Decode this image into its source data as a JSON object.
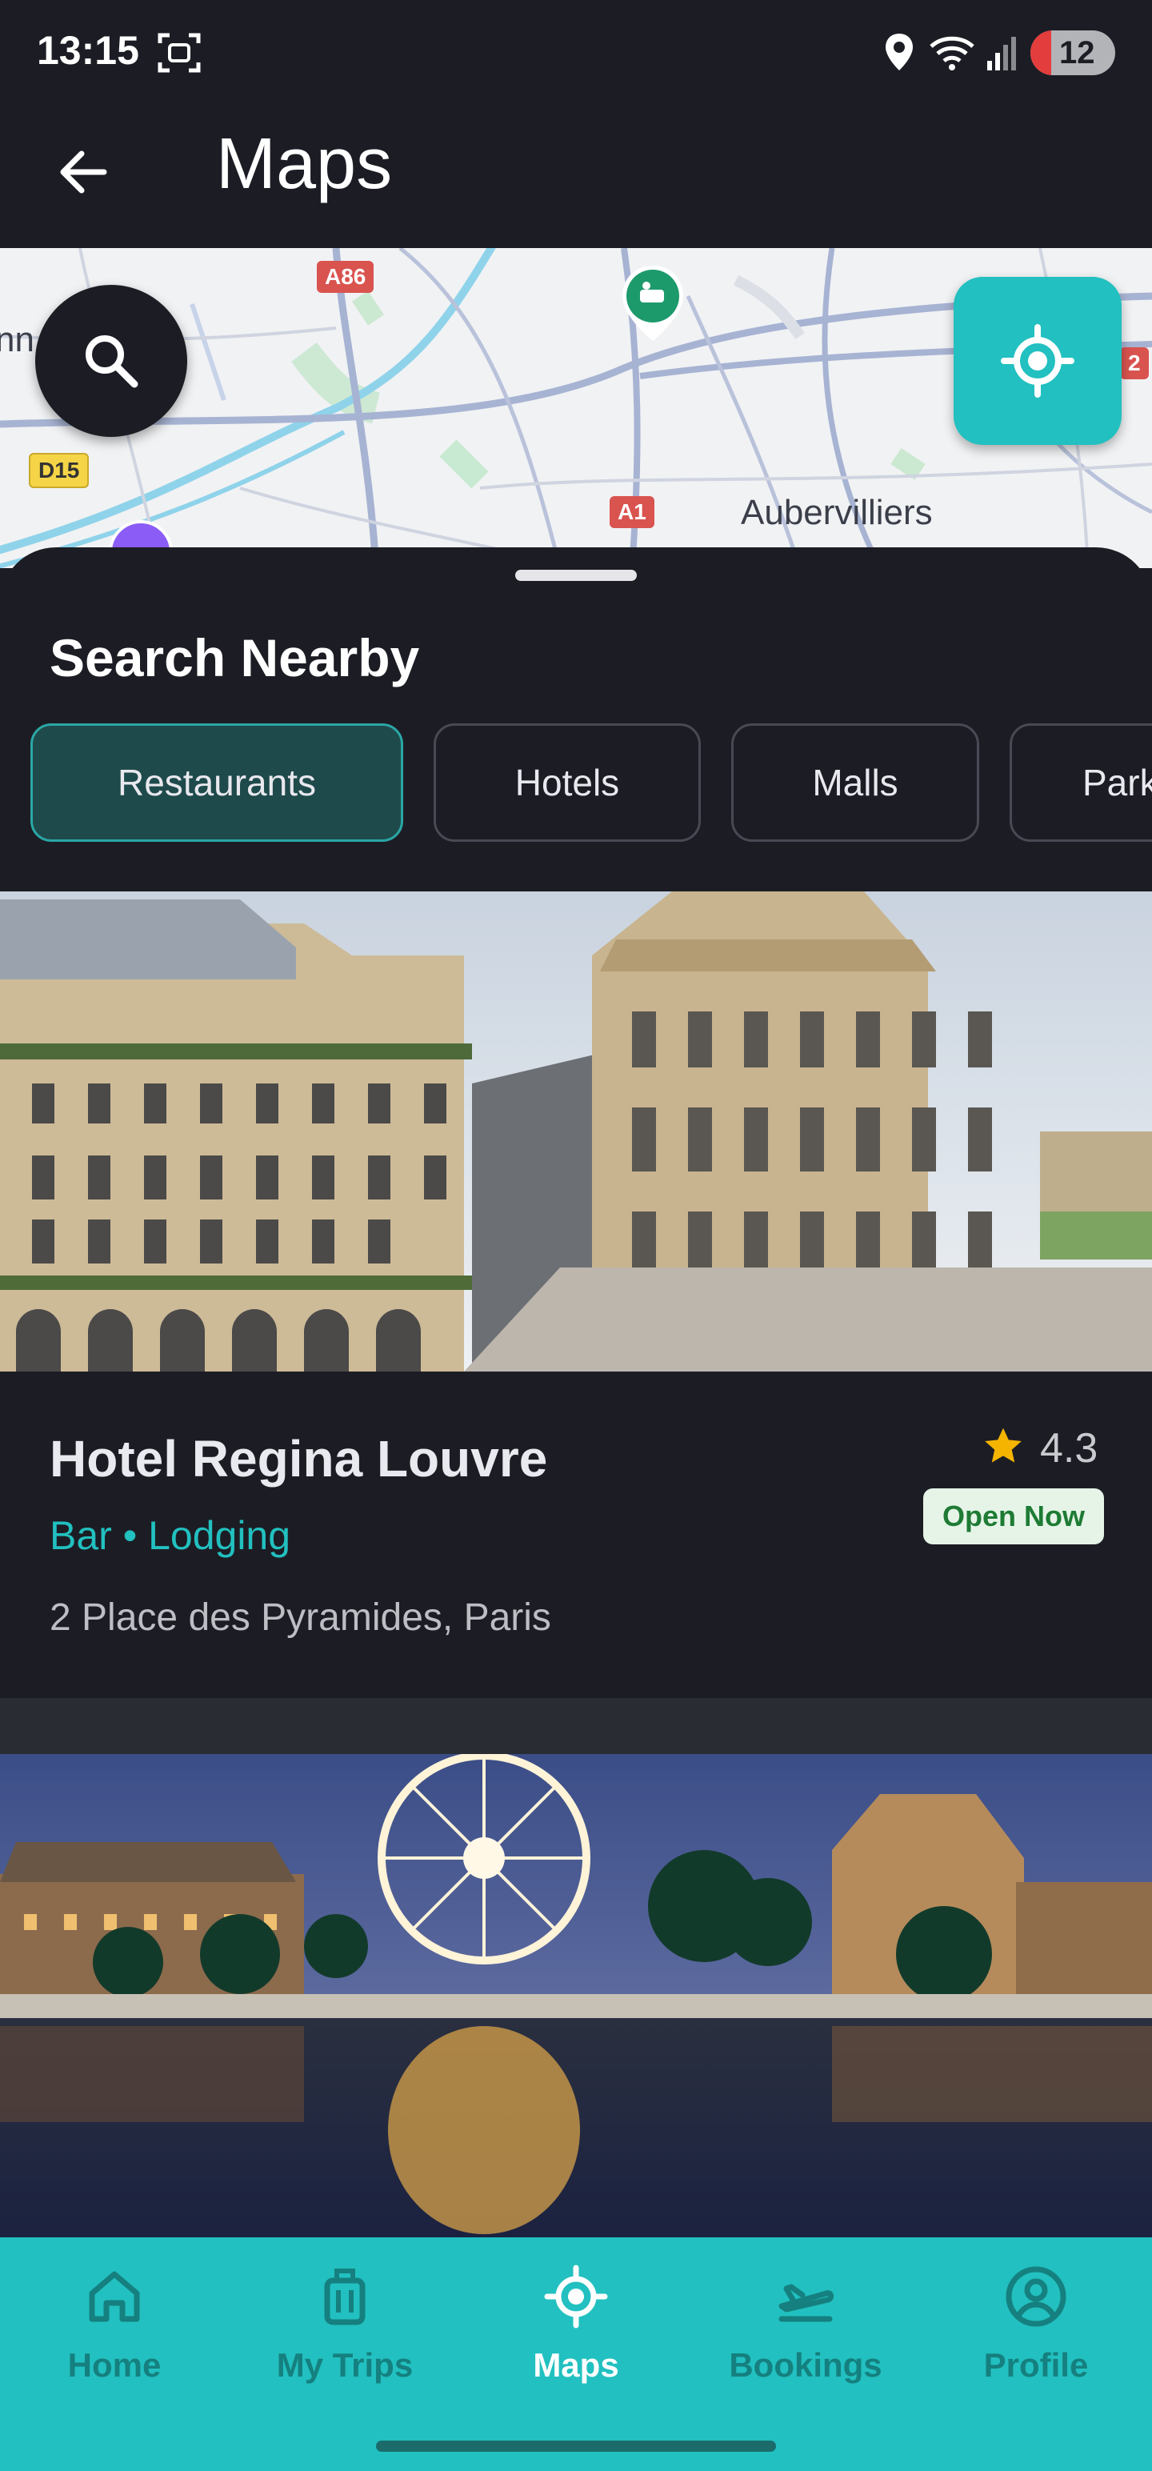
{
  "status_bar": {
    "time": "13:15",
    "battery": "12"
  },
  "app_bar": {
    "title": "Maps"
  },
  "map": {
    "labels": {
      "a86": "A86",
      "d15": "D15",
      "a1": "A1",
      "city": "Aubervilliers",
      "partial_left": "nn",
      "partial_right": "2"
    }
  },
  "search_nearby": {
    "title": "Search Nearby",
    "chips": [
      "Restaurants",
      "Hotels",
      "Malls",
      "Parks"
    ],
    "active_chip": "Restaurants"
  },
  "places": [
    {
      "name": "Hotel Regina Louvre",
      "categories": "Bar • Lodging",
      "address": "2 Place des Pyramides, Paris",
      "rating": "4.3",
      "status": "Open Now"
    }
  ],
  "bottom_nav": {
    "items": [
      {
        "label": "Home",
        "icon": "home-icon"
      },
      {
        "label": "My Trips",
        "icon": "luggage-icon"
      },
      {
        "label": "Maps",
        "icon": "target-icon"
      },
      {
        "label": "Bookings",
        "icon": "flight-icon"
      },
      {
        "label": "Profile",
        "icon": "profile-icon"
      }
    ],
    "active": "Maps"
  },
  "colors": {
    "accent": "#22c0c0",
    "background": "#1c1d24",
    "rating_star": "#f5b400",
    "open_badge_bg": "#e6f4e8",
    "open_badge_text": "#1e7b34",
    "category_text": "#22c0c0"
  }
}
